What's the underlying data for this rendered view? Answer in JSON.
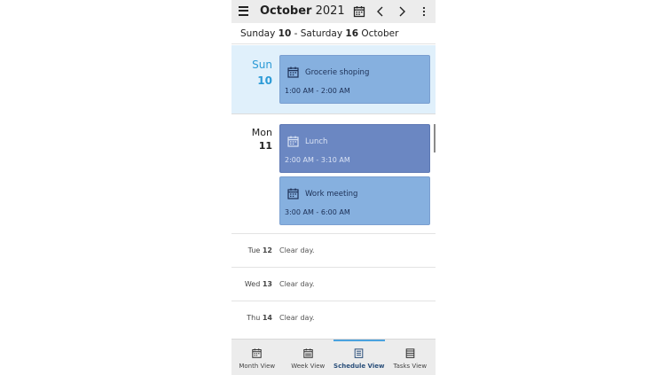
{
  "header": {
    "title_month": "October",
    "title_year": "2021"
  },
  "range": {
    "start_day": "Sunday",
    "start_num": "10",
    "sep": " - ",
    "end_day": "Saturday",
    "end_num": "16",
    "end_month": "October"
  },
  "days": {
    "sun": {
      "name": "Sun",
      "num": "10",
      "events": [
        {
          "title": "Grocerie shoping",
          "time": "1:00 AM - 2:00 AM"
        }
      ]
    },
    "mon": {
      "name": "Mon",
      "num": "11",
      "events": [
        {
          "title": "Lunch",
          "time": "2:00 AM - 3:10 AM"
        },
        {
          "title": "Work meeting",
          "time": "3:00 AM - 6:00 AM"
        }
      ]
    }
  },
  "clear_days": [
    {
      "name": "Tue",
      "num": "12",
      "text": "Clear day."
    },
    {
      "name": "Wed",
      "num": "13",
      "text": "Clear day."
    },
    {
      "name": "Thu",
      "num": "14",
      "text": "Clear day."
    }
  ],
  "tabs": [
    {
      "label": "Month View",
      "icon": "calendar-month-icon"
    },
    {
      "label": "Week View",
      "icon": "calendar-week-icon"
    },
    {
      "label": "Schedule View",
      "icon": "schedule-list-icon",
      "active": true
    },
    {
      "label": "Tasks View",
      "icon": "tasks-list-icon"
    }
  ],
  "colors": {
    "accent": "#2b9ad6",
    "event_light": "#86b0df",
    "event_dark": "#6b87c2",
    "today_bg": "#e0f0fb"
  }
}
